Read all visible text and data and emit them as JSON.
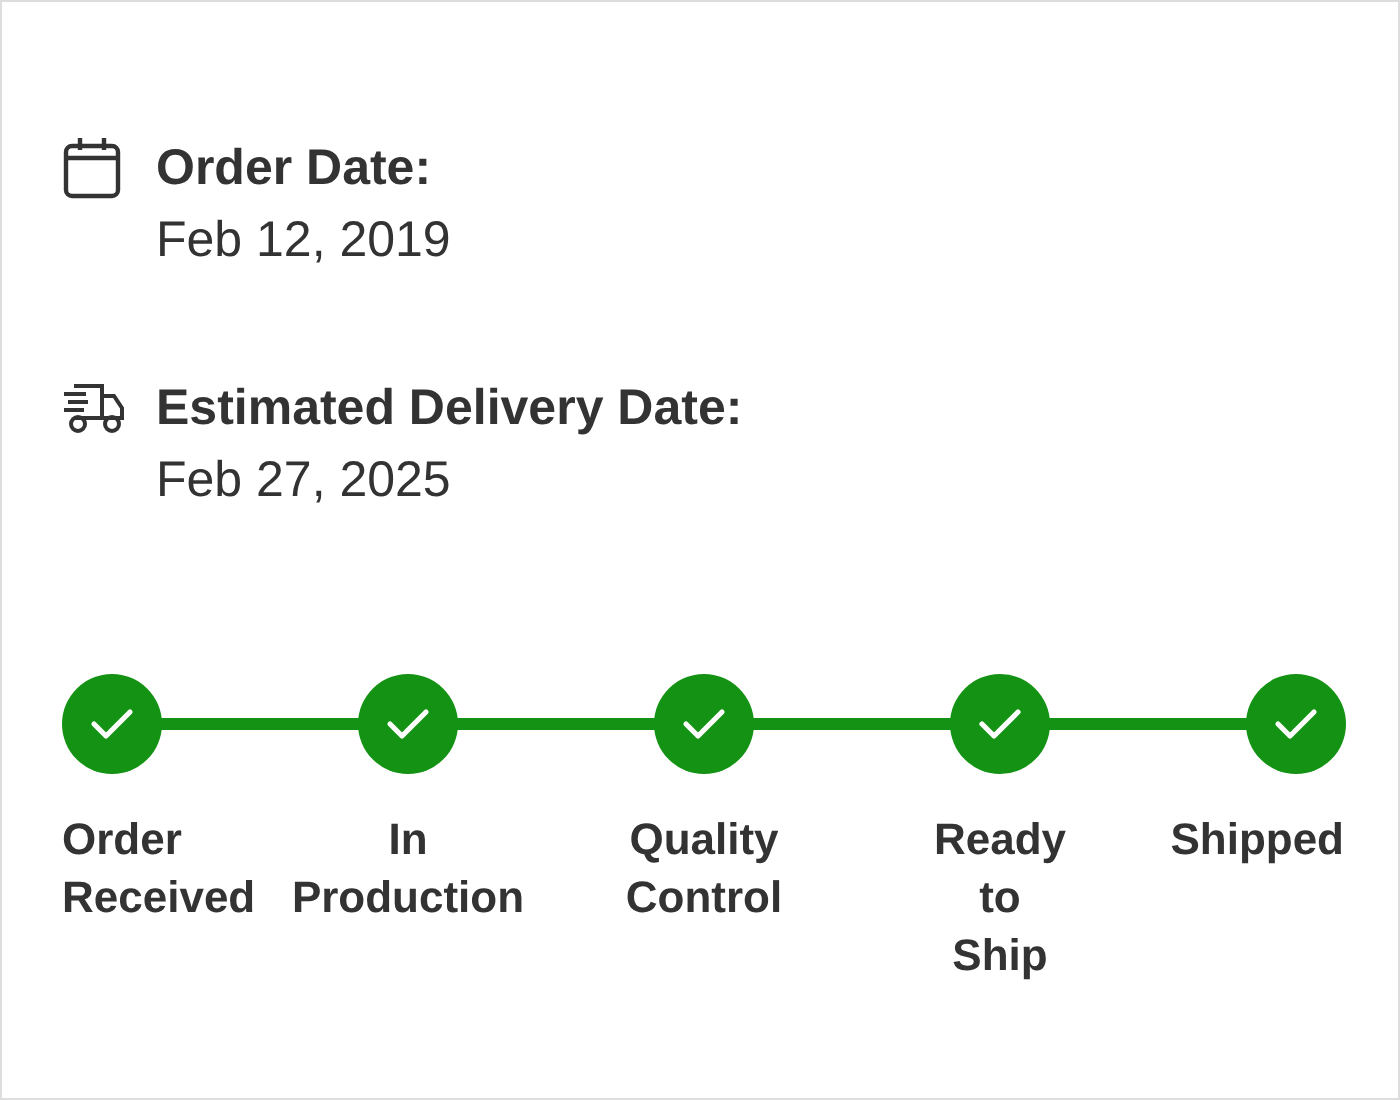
{
  "details": [
    {
      "kind": "calendar",
      "label": "Order Date:",
      "value": "Feb 12, 2019"
    },
    {
      "kind": "truck",
      "label": "Estimated Delivery Date:",
      "value": "Feb 27, 2025"
    }
  ],
  "steps": [
    {
      "label_lines": [
        "Order",
        "Received"
      ],
      "done": true
    },
    {
      "label_lines": [
        "In",
        "Production"
      ],
      "done": true
    },
    {
      "label_lines": [
        "Quality",
        "Control"
      ],
      "done": true
    },
    {
      "label_lines": [
        "Ready",
        "to",
        "Ship"
      ],
      "done": true
    },
    {
      "label_lines": [
        "Shipped"
      ],
      "done": true
    }
  ]
}
